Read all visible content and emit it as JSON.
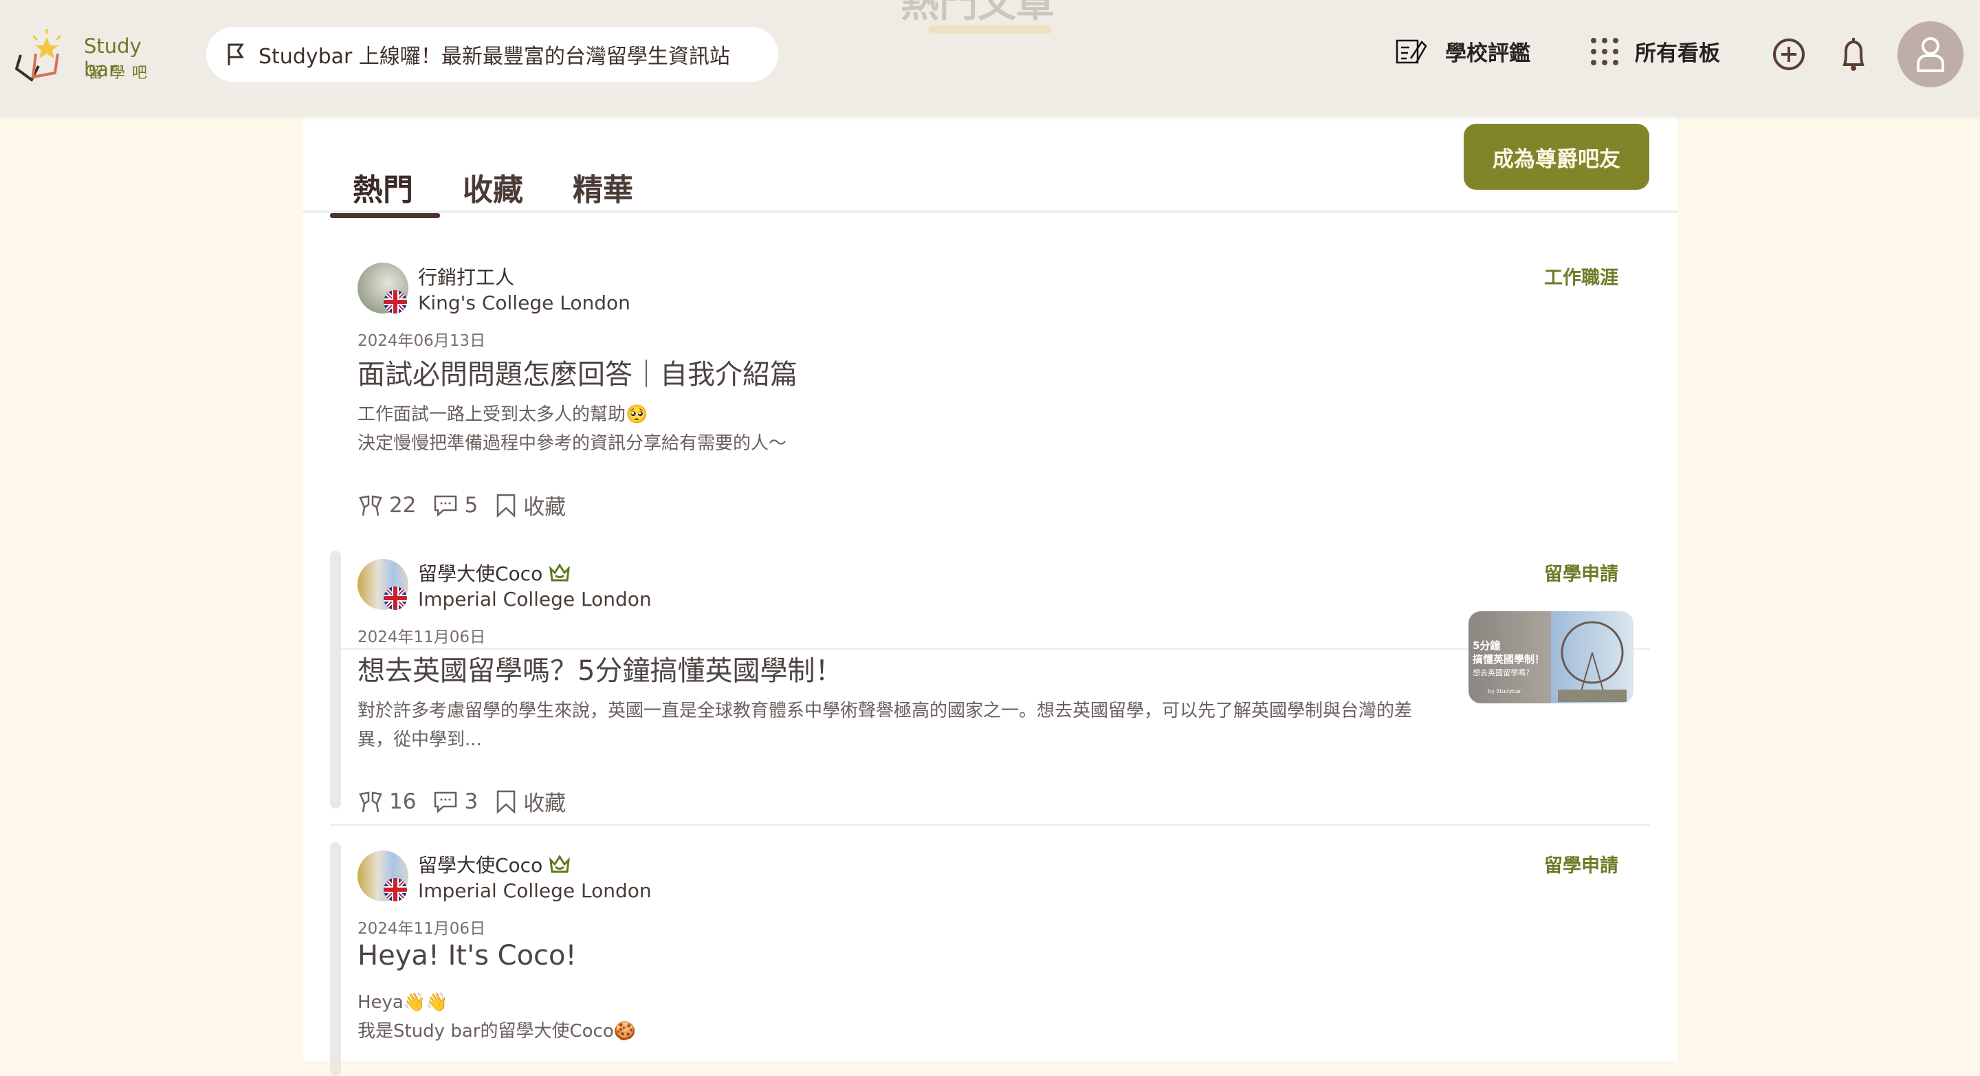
{
  "header": {
    "section_title": "熱門文章",
    "logo": {
      "name_en": "Study bar",
      "name_zh": "留學吧"
    },
    "announcement": "Studybar 上線囉！最新最豐富的台灣留學生資訊站",
    "nav": [
      {
        "label": "學校評鑑",
        "icon": "school-review-icon"
      },
      {
        "label": "所有看板",
        "icon": "grid-dots-icon"
      }
    ],
    "icons": [
      "add-circle-icon",
      "bell-icon",
      "user-avatar-icon"
    ]
  },
  "tabs": [
    {
      "label": "熱門",
      "active": true
    },
    {
      "label": "收藏"
    },
    {
      "label": "精華"
    }
  ],
  "vip_button": "成為尊爵吧友",
  "colors": {
    "brand": "#828429",
    "tag": "#6e7a26",
    "header_bg": "#efece6",
    "page_bg": "#fdf8ea"
  },
  "posts": [
    {
      "author": "行銷打工人",
      "school": "King's College London",
      "date": "2024年06月13日",
      "title": "面試必問問題怎麼回答｜自我介紹篇",
      "body": [
        "工作面試一路上受到太多人的幫助🥺",
        "決定慢慢把準備過程中參考的資訊分享給有需要的人～"
      ],
      "tag": "工作職涯",
      "likes": "22",
      "comments": "5",
      "save_label": "收藏",
      "verified": false
    },
    {
      "author": "留學大使Coco",
      "school": "Imperial College London",
      "date": "2024年11月06日",
      "title": "想去英國留學嗎？5分鐘搞懂英國學制！",
      "body": [
        "對於許多考慮留學的學生來說，英國一直是全球教育體系中學術聲譽極高的國家之一。想去英國留學，可以先了解英國學制與台灣的差異，從中學到..."
      ],
      "tag": "留學申請",
      "likes": "16",
      "comments": "3",
      "save_label": "收藏",
      "verified": true,
      "thumbnail": {
        "line1": "5分鐘",
        "line2": "搞懂英國學制！",
        "line3": "想去英國留學嗎？",
        "credit": "by Studybar"
      }
    },
    {
      "author": "留學大使Coco",
      "school": "Imperial College London",
      "date": "2024年11月06日",
      "title": "Heya! It's Coco!",
      "body": [
        "Heya👋👋",
        "我是Study bar的留學大使Coco🍪"
      ],
      "tag": "留學申請",
      "verified": true
    }
  ]
}
